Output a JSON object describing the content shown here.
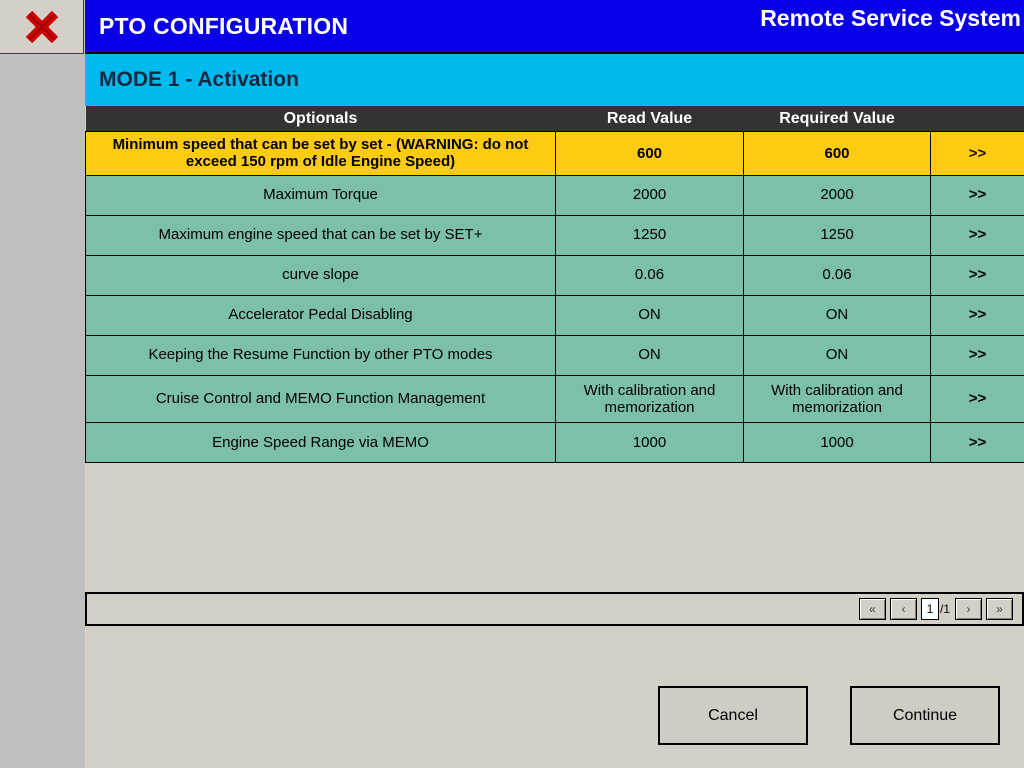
{
  "window": {
    "close_icon": "close-x-icon"
  },
  "header": {
    "title": "PTO CONFIGURATION",
    "brand": "Remote Service System",
    "mode": "MODE 1 - Activation",
    "title_bg": "#0a00e8",
    "mode_bg": "#00b9ee"
  },
  "table": {
    "columns": [
      "Optionals",
      "Read Value",
      "Required Value",
      ""
    ],
    "header_bg": "#333333",
    "warning_bg": "#fdcb11",
    "normal_bg": "#7cc0a9",
    "arrow_label": ">>",
    "rows": [
      {
        "optional": "Minimum speed that can be set by set - (WARNING: do not exceed 150 rpm of Idle Engine Speed)",
        "read_value": "600",
        "required_value": "600",
        "arrow": ">>",
        "highlight": "warning"
      },
      {
        "optional": "Maximum Torque",
        "read_value": "2000",
        "required_value": "2000",
        "arrow": ">>",
        "highlight": "normal"
      },
      {
        "optional": "Maximum engine speed that can be set by SET+",
        "read_value": "1250",
        "required_value": "1250",
        "arrow": ">>",
        "highlight": "normal"
      },
      {
        "optional": "curve slope",
        "read_value": "0.06",
        "required_value": "0.06",
        "arrow": ">>",
        "highlight": "normal"
      },
      {
        "optional": "Accelerator Pedal Disabling",
        "read_value": "ON",
        "required_value": "ON",
        "arrow": ">>",
        "highlight": "normal"
      },
      {
        "optional": "Keeping the Resume Function by other PTO modes",
        "read_value": "ON",
        "required_value": "ON",
        "arrow": ">>",
        "highlight": "normal"
      },
      {
        "optional": "Cruise Control and MEMO Function Management",
        "read_value": "With calibration and memorization",
        "required_value": "With calibration and memorization",
        "arrow": ">>",
        "highlight": "normal"
      },
      {
        "optional": "Engine Speed Range via MEMO",
        "read_value": "1000",
        "required_value": "1000",
        "arrow": ">>",
        "highlight": "normal"
      }
    ]
  },
  "pager": {
    "first_label": "«",
    "prev_label": "‹",
    "current_page": "1",
    "total_pages": "/1",
    "next_label": "›",
    "last_label": "»"
  },
  "footer": {
    "cancel_label": "Cancel",
    "continue_label": "Continue"
  }
}
